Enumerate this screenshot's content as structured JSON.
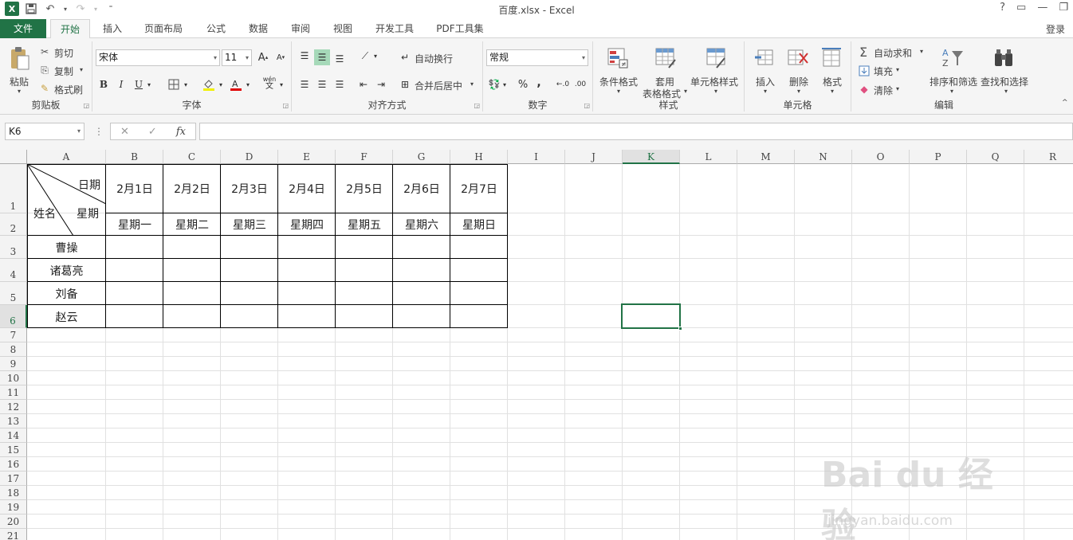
{
  "window": {
    "title": "百度.xlsx - Excel",
    "app_icon": "X",
    "controls": [
      "?",
      "▭",
      "—",
      "❐"
    ]
  },
  "tabs": [
    {
      "label": "文件"
    },
    {
      "label": "开始"
    },
    {
      "label": "插入"
    },
    {
      "label": "页面布局"
    },
    {
      "label": "公式"
    },
    {
      "label": "数据"
    },
    {
      "label": "审阅"
    },
    {
      "label": "视图"
    },
    {
      "label": "开发工具"
    },
    {
      "label": "PDF工具集"
    }
  ],
  "login": "登录",
  "ribbon": {
    "clipboard": {
      "label": "剪贴板",
      "paste": "粘贴",
      "cut": "剪切",
      "copy": "复制",
      "format_painter": "格式刷"
    },
    "font": {
      "label": "字体",
      "font_name": "宋体",
      "font_size": "11",
      "bold": "B",
      "italic": "I",
      "underline": "U",
      "grow": "A",
      "shrink": "A",
      "phonetic": "wén"
    },
    "alignment": {
      "label": "对齐方式",
      "wrap": "自动换行",
      "merge": "合并后居中"
    },
    "number": {
      "label": "数字",
      "format": "常规",
      "percent": "%",
      "comma": ","
    },
    "styles": {
      "label": "样式",
      "conditional": "条件格式",
      "table_line1": "套用",
      "table_line2": "表格格式",
      "cell_styles": "单元格样式"
    },
    "cells": {
      "label": "单元格",
      "insert": "插入",
      "delete": "删除",
      "format": "格式"
    },
    "editing": {
      "label": "编辑",
      "autosum": "自动求和",
      "fill": "填充",
      "clear": "清除",
      "sort": "排序和筛选",
      "find": "查找和选择"
    }
  },
  "formula_bar": {
    "name_box": "K6",
    "fx": "fx",
    "formula": ""
  },
  "columns": [
    "A",
    "B",
    "C",
    "D",
    "E",
    "F",
    "G",
    "H",
    "I",
    "J",
    "K",
    "L",
    "M",
    "N",
    "O",
    "P",
    "Q",
    "R"
  ],
  "rows": [
    "1",
    "2",
    "3",
    "4",
    "5",
    "6",
    "7",
    "8",
    "9",
    "10",
    "11",
    "12",
    "13",
    "14",
    "15",
    "16",
    "17",
    "18",
    "19",
    "20",
    "21"
  ],
  "table": {
    "header_date": "日期",
    "header_week": "星期",
    "header_name": "姓名",
    "dates": [
      "2月1日",
      "2月2日",
      "2月3日",
      "2月4日",
      "2月5日",
      "2月6日",
      "2月7日"
    ],
    "weekdays": [
      "星期一",
      "星期二",
      "星期三",
      "星期四",
      "星期五",
      "星期六",
      "星期日"
    ],
    "names": [
      "曹操",
      "诸葛亮",
      "刘备",
      "赵云"
    ]
  },
  "selected_cell": "K6",
  "accent_color": "#217346",
  "watermark": {
    "main": "Bai du 经验",
    "sub": "jingyan.baidu.com"
  }
}
